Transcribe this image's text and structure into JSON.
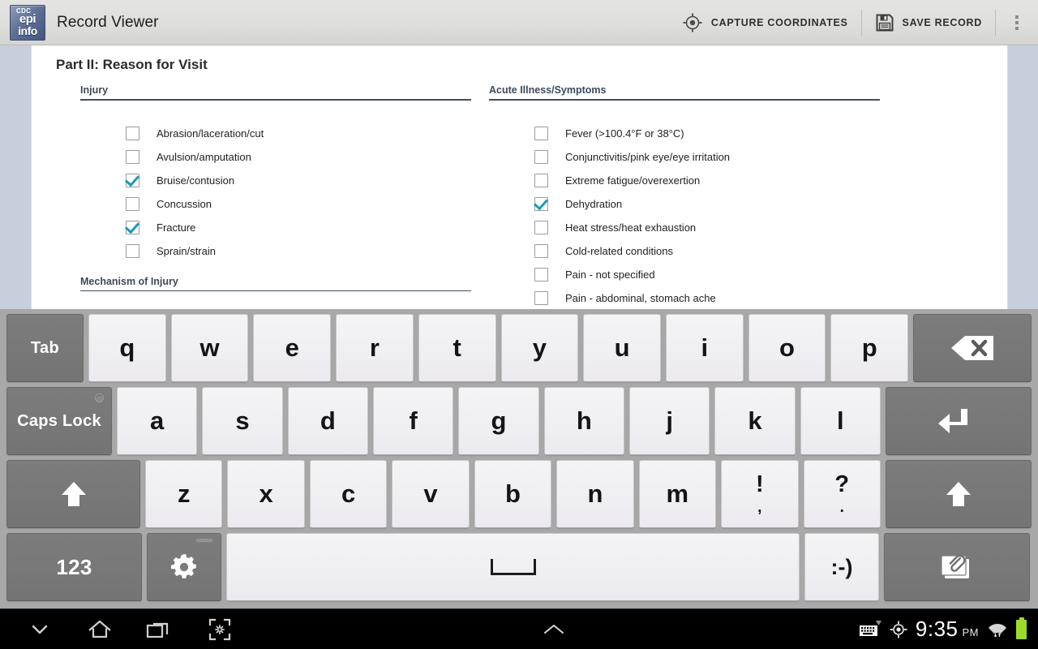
{
  "app": {
    "title": "Record Viewer",
    "logo": {
      "cdc": "CDC",
      "epi": "epi",
      "info": "info"
    }
  },
  "toolbar": {
    "capture_coordinates_label": "CAPTURE COORDINATES",
    "save_record_label": "SAVE RECORD",
    "capture_icon": "crosshair-target-icon",
    "save_icon": "floppy-disk-icon",
    "overflow_icon": "overflow-menu-icon"
  },
  "form": {
    "part_title": "Part II: Reason for Visit",
    "left": {
      "section_label": "Injury",
      "items": [
        {
          "label": "Abrasion/laceration/cut",
          "checked": false
        },
        {
          "label": "Avulsion/amputation",
          "checked": false
        },
        {
          "label": "Bruise/contusion",
          "checked": true
        },
        {
          "label": "Concussion",
          "checked": false
        },
        {
          "label": "Fracture",
          "checked": true
        },
        {
          "label": "Sprain/strain",
          "checked": false
        }
      ],
      "second_section_label": "Mechanism of Injury"
    },
    "right": {
      "section_label": "Acute Illness/Symptoms",
      "items": [
        {
          "label": "Fever (>100.4°F or 38°C)",
          "checked": false
        },
        {
          "label": "Conjunctivitis/pink eye/eye irritation",
          "checked": false
        },
        {
          "label": "Extreme fatigue/overexertion",
          "checked": false
        },
        {
          "label": "Dehydration",
          "checked": true
        },
        {
          "label": "Heat stress/heat exhaustion",
          "checked": false
        },
        {
          "label": "Cold-related conditions",
          "checked": false
        },
        {
          "label": "Pain - not specified",
          "checked": false
        },
        {
          "label": "Pain - abdominal, stomach ache",
          "checked": false
        }
      ]
    }
  },
  "keyboard": {
    "row1": [
      {
        "name": "tab",
        "label": "Tab",
        "style": "dark",
        "width": "w-tab"
      },
      {
        "name": "q",
        "label": "q"
      },
      {
        "name": "w",
        "label": "w"
      },
      {
        "name": "e",
        "label": "e"
      },
      {
        "name": "r",
        "label": "r"
      },
      {
        "name": "t",
        "label": "t"
      },
      {
        "name": "y",
        "label": "y"
      },
      {
        "name": "u",
        "label": "u"
      },
      {
        "name": "i",
        "label": "i"
      },
      {
        "name": "o",
        "label": "o"
      },
      {
        "name": "p",
        "label": "p"
      },
      {
        "name": "backspace",
        "label": "",
        "style": "dark",
        "width": "w-bksp",
        "icon": "backspace-icon"
      }
    ],
    "row2": [
      {
        "name": "caps-lock",
        "label": "Caps Lock",
        "style": "dark",
        "width": "w-caps",
        "led": true
      },
      {
        "name": "a",
        "label": "a"
      },
      {
        "name": "s",
        "label": "s"
      },
      {
        "name": "d",
        "label": "d"
      },
      {
        "name": "f",
        "label": "f"
      },
      {
        "name": "g",
        "label": "g"
      },
      {
        "name": "h",
        "label": "h"
      },
      {
        "name": "j",
        "label": "j"
      },
      {
        "name": "k",
        "label": "k"
      },
      {
        "name": "l",
        "label": "l"
      },
      {
        "name": "enter",
        "label": "",
        "style": "dark",
        "width": "w-enter",
        "icon": "enter-return-icon"
      }
    ],
    "row3": [
      {
        "name": "shift-left",
        "label": "",
        "style": "dark",
        "width": "w-shift",
        "icon": "shift-up-arrow-icon"
      },
      {
        "name": "z",
        "label": "z"
      },
      {
        "name": "x",
        "label": "x"
      },
      {
        "name": "c",
        "label": "c"
      },
      {
        "name": "v",
        "label": "v"
      },
      {
        "name": "b",
        "label": "b"
      },
      {
        "name": "n",
        "label": "n"
      },
      {
        "name": "m",
        "label": "m"
      },
      {
        "name": "exclamation-comma",
        "primary": "!",
        "secondary": ",",
        "kind": "punct"
      },
      {
        "name": "question-period",
        "primary": "?",
        "secondary": ".",
        "kind": "punct"
      },
      {
        "name": "shift-right",
        "label": "",
        "style": "dark",
        "width": "w-shiftr",
        "icon": "shift-up-arrow-icon"
      }
    ],
    "row4": [
      {
        "name": "numbers-123",
        "label": "123",
        "style": "dark",
        "width": "w-123"
      },
      {
        "name": "settings",
        "label": "",
        "style": "dark",
        "width": "w-gear",
        "icon": "gear-icon",
        "led": true
      },
      {
        "name": "space",
        "label": "",
        "width": "w-space",
        "icon": "spacebar-icon"
      },
      {
        "name": "emoticon",
        "label": ":-)",
        "width": "w-emoji"
      },
      {
        "name": "attachment",
        "label": "",
        "style": "dark",
        "width": "w-clip",
        "icon": "paperclip-attachment-icon"
      }
    ]
  },
  "navbar": {
    "back_icon": "chevron-down-back-icon",
    "home_icon": "home-icon",
    "recents_icon": "recent-apps-icon",
    "screenshot_icon": "screenshot-icon",
    "expand_icon": "chevron-up-icon",
    "keyboard_icon": "keyboard-indicator-icon",
    "location_icon": "location-crosshair-icon",
    "wifi_icon": "wifi-icon",
    "battery_icon": "battery-full-icon",
    "time": "9:35",
    "ampm": "PM"
  },
  "colors": {
    "accent_check": "#1a9bb8",
    "section_label": "#3c4a5a",
    "page_margin": "#c8cfdc",
    "keyboard_bg": "#a8a8a8",
    "battery": "#9ddb2b"
  }
}
